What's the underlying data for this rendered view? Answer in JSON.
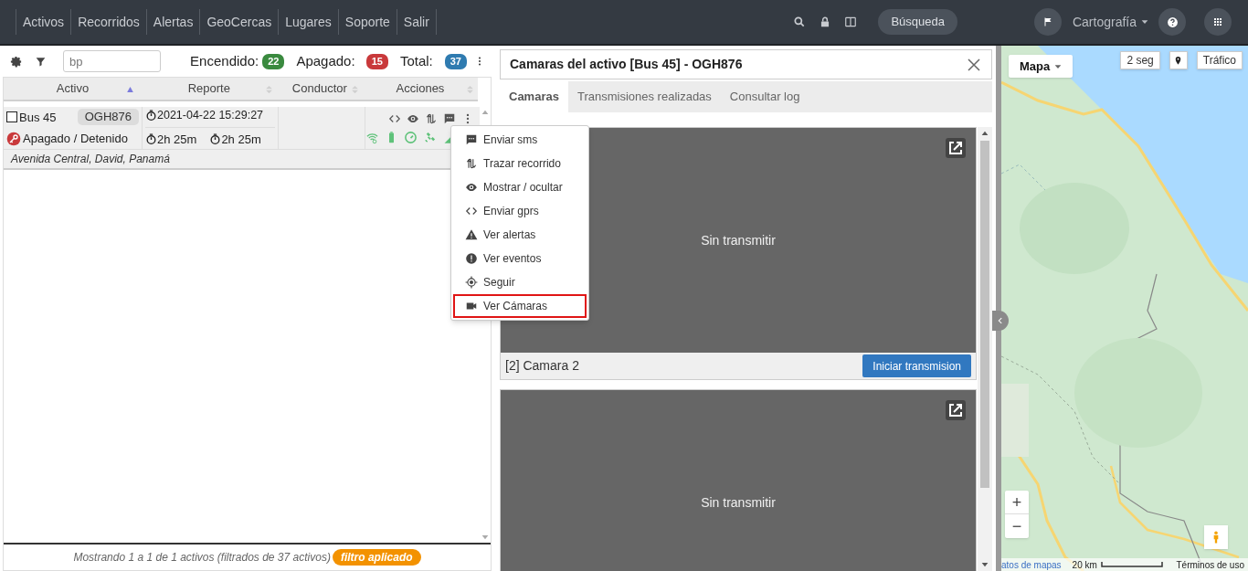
{
  "nav": {
    "items": [
      "Activos",
      "Recorridos",
      "Alertas",
      "GeoCercas",
      "Lugares",
      "Soporte",
      "Salir"
    ],
    "search_button": "Búsqueda",
    "cartography": "Cartografía"
  },
  "toolbar": {
    "filter_value": "bp",
    "counters": [
      {
        "label": "Encendido:",
        "count": "22",
        "color": "#3a8a3f"
      },
      {
        "label": "Apagado:",
        "count": "15",
        "color": "#c9393b"
      },
      {
        "label": "Total:",
        "count": "37",
        "color": "#2f7bb0"
      }
    ]
  },
  "table": {
    "columns": [
      {
        "label": "Activo",
        "sorted": true
      },
      {
        "label": "Reporte",
        "sorted": false
      },
      {
        "label": "Conductor",
        "sorted": false
      },
      {
        "label": "Acciones",
        "sorted": false
      }
    ],
    "rows": [
      {
        "name": "Bus 45",
        "checked": false,
        "plate": "OGH876",
        "status": "Apagado / Detenido",
        "report": "2021-04-22 15:29:27",
        "durations": [
          "2h 25m",
          "2h 25m"
        ],
        "address": "Avenida Central, David, Panamá"
      }
    ],
    "footer": "Mostrando 1 a 1 de 1 activos (filtrados de 37 activos)",
    "filter_badge": "filtro aplicado"
  },
  "context_menu": [
    {
      "label": "Enviar sms",
      "highlighted": false
    },
    {
      "label": "Trazar recorrido",
      "highlighted": false
    },
    {
      "label": "Mostrar / ocultar",
      "highlighted": false
    },
    {
      "label": "Enviar gprs",
      "highlighted": false
    },
    {
      "label": "Ver alertas",
      "highlighted": false
    },
    {
      "label": "Ver eventos",
      "highlighted": false
    },
    {
      "label": "Seguir",
      "highlighted": false
    },
    {
      "label": "Ver Cámaras",
      "highlighted": true
    }
  ],
  "dialog": {
    "title": "Camaras del activo [Bus 45] - OGH876",
    "tabs": [
      {
        "label": "Camaras",
        "selected": true
      },
      {
        "label": "Transmisiones realizadas",
        "selected": false
      },
      {
        "label": "Consultar log",
        "selected": false
      }
    ],
    "cameras": [
      {
        "status": "Sin transmitir",
        "label": "[2] Camara 2",
        "button": "Iniciar transmision"
      },
      {
        "status": "Sin transmitir"
      }
    ]
  },
  "map": {
    "type_button": "Mapa",
    "refresh_button": "2 seg",
    "traffic_button": "Tráfico",
    "zoom_in": "+",
    "zoom_out": "−",
    "attribution": "atos de mapas",
    "scale": "20 km",
    "terms": "Términos de uso"
  }
}
